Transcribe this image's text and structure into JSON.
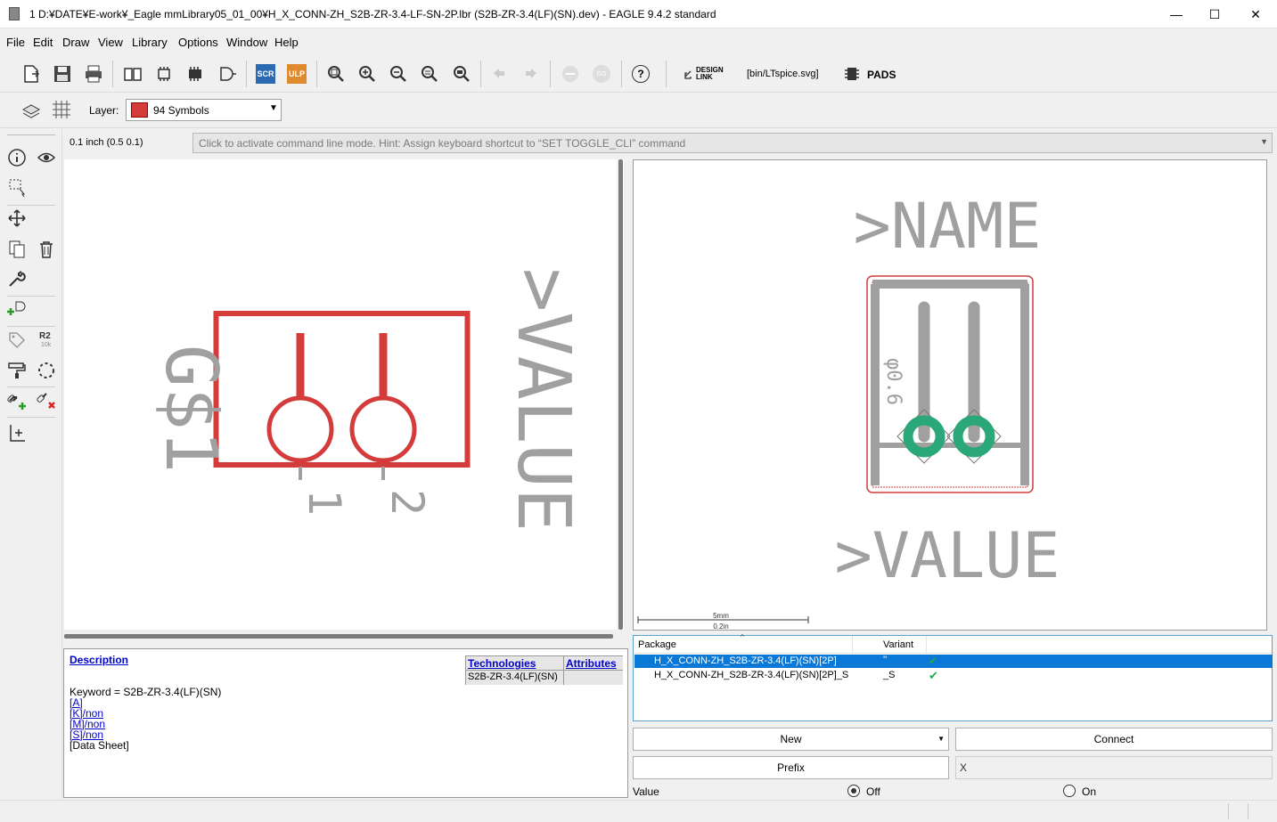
{
  "window": {
    "title": "1 D:¥DATE¥E-work¥_Eagle mmLibrary05_01_00¥H_X_CONN-ZH_S2B-ZR-3.4-LF-SN-2P.lbr (S2B-ZR-3.4(LF)(SN).dev) - EAGLE 9.4.2 standard",
    "minimize": "—",
    "maximize": "☐",
    "close": "✕"
  },
  "menu": [
    "File",
    "Edit",
    "Draw",
    "View",
    "Library",
    "Options",
    "Window",
    "Help"
  ],
  "toolbar": {
    "scr_label": "SCR",
    "ulp_label": "ULP",
    "design_link_label_1": "DESIGN",
    "design_link_label_2": "LINK",
    "script_label": "[bin/LTspice.svg]",
    "pads_label": "PADS",
    "help_label": "?",
    "go_label": "GO"
  },
  "layerbar": {
    "label": "Layer:",
    "selected": "94 Symbols",
    "color": "#d43c3c"
  },
  "coords": "0.1 inch (0.5 0.1)",
  "command_placeholder": "Click to activate command line mode. Hint: Assign keyboard shortcut to “SET TOGGLE_CLI” command",
  "leftbar": {
    "r2_label": "R2",
    "r2_sub": "10k"
  },
  "symbol": {
    "name_text": "G$1",
    "value_text": ">VALUE",
    "pin1": "1",
    "pin2": "2",
    "body_color": "#d43c3c",
    "text_color": "#a0a0a0"
  },
  "package": {
    "name_text": ">NAME",
    "value_text": ">VALUE",
    "hole_label": "φ0.6",
    "pad_color": "#2aa87a",
    "scale_mm": "5mm",
    "scale_in": "0.2in"
  },
  "description": {
    "heading": "Description",
    "keyword": "Keyword = S2B-ZR-3.4(LF)(SN)",
    "links": [
      "[A]",
      "[K]/non",
      "[M]/non",
      "[S]/non"
    ],
    "datasheet": "[Data Sheet]",
    "tech_header": "Technologies",
    "attr_header": "Attributes",
    "tech_value": "S2B-ZR-3.4(LF)(SN)"
  },
  "package_table": {
    "col_package": "Package",
    "col_variant": "Variant",
    "rows": [
      {
        "package": "H_X_CONN-ZH_S2B-ZR-3.4(LF)(SN)[2P]",
        "variant": "''",
        "check": "✔"
      },
      {
        "package": "H_X_CONN-ZH_S2B-ZR-3.4(LF)(SN)[2P]_S",
        "variant": "_S",
        "check": "✔"
      }
    ],
    "selection_color": "#0a78d7"
  },
  "buttons": {
    "new": "New",
    "connect": "Connect",
    "prefix": "Prefix",
    "prefix_value": "X"
  },
  "value_row": {
    "label": "Value",
    "off": "Off",
    "on": "On"
  }
}
